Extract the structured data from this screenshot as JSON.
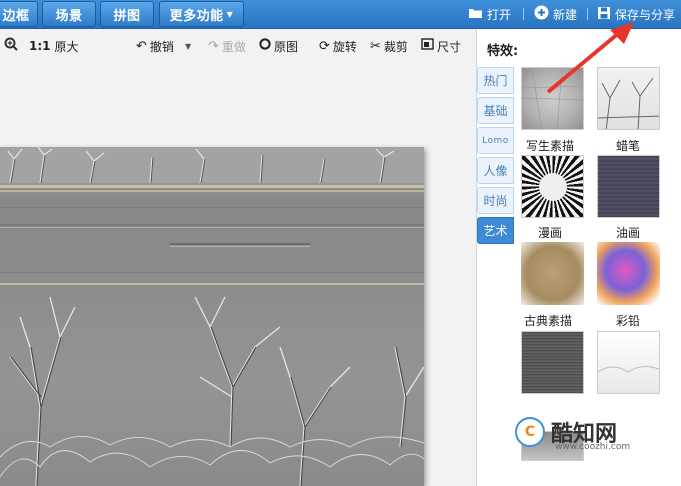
{
  "topbar": {
    "tabs": [
      {
        "label": "边框"
      },
      {
        "label": "场景"
      },
      {
        "label": "拼图"
      },
      {
        "label": "更多功能"
      }
    ],
    "open_label": "打开",
    "new_label": "新建",
    "save_label": "保存与分享"
  },
  "toolbar": {
    "zoom_ratio": "1:1",
    "original_size": "原大",
    "undo": "撤销",
    "redo": "重做",
    "original_image": "原图",
    "rotate": "旋转",
    "crop": "裁剪",
    "size": "尺寸"
  },
  "panel": {
    "title": "特效:",
    "categories": [
      {
        "label": "热门"
      },
      {
        "label": "基础"
      },
      {
        "label": "Lomo"
      },
      {
        "label": "人像"
      },
      {
        "label": "时尚"
      },
      {
        "label": "艺术"
      }
    ],
    "effects": [
      {
        "label": "写生素描"
      },
      {
        "label": "蜡笔"
      },
      {
        "label": "漫画"
      },
      {
        "label": "油画"
      },
      {
        "label": "古典素描"
      },
      {
        "label": "彩铅"
      }
    ]
  },
  "watermark": {
    "title": "酷知网",
    "url": "www.coozhi.com",
    "logo_text": "C"
  },
  "colors": {
    "accent": "#2a74c3",
    "tab_active": "#3d8bd6",
    "arrow": "#e8352b"
  }
}
